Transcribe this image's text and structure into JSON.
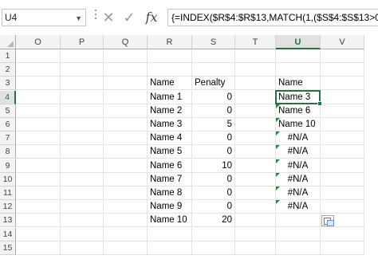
{
  "formula_bar": {
    "name_box": "U4",
    "name_box_dropdown_icon": "chevron-down-icon",
    "cancel_icon": "cancel-x-icon",
    "enter_icon": "checkmark-icon",
    "fx_label": "fx",
    "formula": "{=INDEX($R$4:$R$13,MATCH(1,($S$4:$S$13>0)*(CO"
  },
  "columns": [
    "O",
    "P",
    "Q",
    "R",
    "S",
    "T",
    "U",
    "V"
  ],
  "rows": [
    "1",
    "2",
    "3",
    "4",
    "5",
    "6",
    "7",
    "8",
    "9",
    "10",
    "11",
    "12",
    "13",
    "14",
    "15"
  ],
  "table": {
    "header_name": "Name",
    "header_penalty": "Penalty",
    "names": [
      "Name 1",
      "Name 2",
      "Name 3",
      "Name 4",
      "Name 5",
      "Name 6",
      "Name 7",
      "Name 8",
      "Name 9",
      "Name 10"
    ],
    "penalties": [
      "0",
      "0",
      "5",
      "0",
      "0",
      "10",
      "0",
      "0",
      "0",
      "20"
    ]
  },
  "result": {
    "header": "Name",
    "values": [
      "Name 3",
      "Name 6",
      "Name 10",
      "#N/A",
      "#N/A",
      "#N/A",
      "#N/A",
      "#N/A",
      "#N/A"
    ]
  },
  "colors": {
    "selection": "#217346",
    "error_indicator": "#1e8c3a"
  },
  "active_cell": "U4"
}
